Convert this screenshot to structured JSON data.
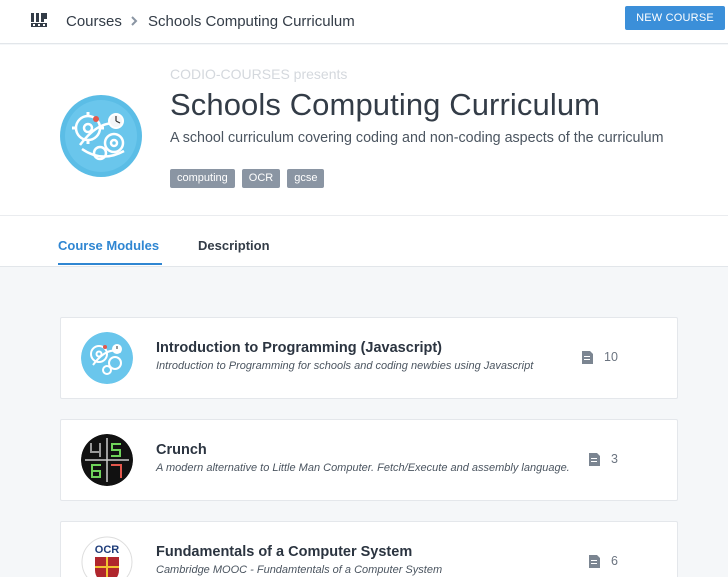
{
  "header": {
    "breadcrumb": [
      "Courses",
      "Schools Computing Curriculum"
    ],
    "new_course_label": "NEW COURSE"
  },
  "course": {
    "presents": "CODIO-COURSES presents",
    "title": "Schools Computing Curriculum",
    "description": "A school curriculum covering coding and non-coding aspects of the curriculum",
    "tags": [
      "computing",
      "OCR",
      "gcse"
    ]
  },
  "tabs": [
    {
      "label": "Course Modules",
      "active": true
    },
    {
      "label": "Description",
      "active": false
    }
  ],
  "modules": [
    {
      "title": "Introduction to Programming (Javascript)",
      "subtitle": "Introduction to Programming for schools and coding newbies using Javascript",
      "count": "10",
      "icon": "gears-icon"
    },
    {
      "title": "Crunch",
      "subtitle": "A modern alternative to Little Man Computer. Fetch/Execute and assembly language.",
      "count": "3",
      "icon": "led-digits-icon"
    },
    {
      "title": "Fundamentals of a Computer System",
      "subtitle": "Cambridge MOOC - Fundamtentals of a Computer System",
      "count": "6",
      "icon": "ocr-crest-icon"
    }
  ],
  "colors": {
    "accent": "#2f86d2",
    "button": "#3b8fd9",
    "tag": "#8a95a3",
    "background": "#f5f7f9"
  }
}
